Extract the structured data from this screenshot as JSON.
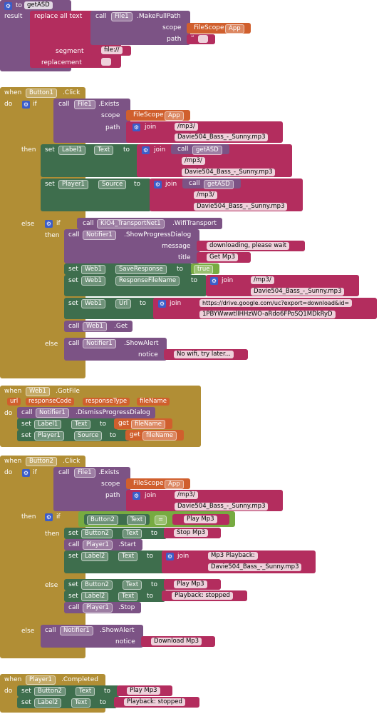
{
  "labels": {
    "to": "to",
    "result": "result",
    "call": "call",
    "when": "when",
    "do": "do",
    "if": "if",
    "then": "then",
    "else": "else",
    "set": "set",
    "get": "get",
    "join": "join",
    "scope": "scope",
    "path": "path",
    "segment": "segment",
    "replacement": "replacement",
    "replace_all_text": "replace all text",
    "message": "message",
    "title": "title",
    "notice": "notice",
    "eq": "=",
    "url": "url",
    "responseCode": "responseCode",
    "responseType": "responseType",
    "fileName": "fileName"
  },
  "proc": {
    "name": "getASD",
    "file_comp": "File1",
    "method": ".MakeFullPath",
    "scope_comp": "FileScope",
    "scope_val": "App",
    "path_val": "",
    "segment_val": "file://",
    "replacement_val": ""
  },
  "button1": {
    "component": "Button1",
    "event": ".Click",
    "file": "File1",
    "exists": ".Exists",
    "scope_comp": "FileScope",
    "scope_val": "App",
    "path1": "/mp3/",
    "path2": "Davie504_Bass_-_Sunny.mp3",
    "label": "Label1",
    "text_prop": "Text",
    "getasd": "getASD",
    "lbl_path1": "/mp3/",
    "lbl_path2": "Davie504_Bass_-_Sunny.mp3",
    "player": "Player1",
    "source_prop": "Source",
    "pl_getasd": "getASD",
    "pl_path1": "/mp3/",
    "pl_path2": "Davie504_Bass_-_Sunny.mp3",
    "kio": "KIO4_TransportNet1",
    "wifi": ".WifiTransport",
    "notifier": "Notifier1",
    "show_progress": ".ShowProgressDialog",
    "message": "downloading, please wait",
    "title": "Get Mp3",
    "web": "Web1",
    "save_prop": "SaveResponse",
    "true_val": "true",
    "resp_file_prop": "ResponseFileName",
    "rf_path1": "/mp3/",
    "rf_path2": "Davie504_Bass_-_Sunny.mp3",
    "url_prop": "Url",
    "url1": "https://drive.google.com/uc?export=download&id=",
    "url2": "1PBYWwwtlIHHzWO-aRdo6FPoSQ1MDkRyD",
    "get_method": ".Get",
    "show_alert": ".ShowAlert",
    "no_wifi": "No wifi, try later..."
  },
  "web1": {
    "component": "Web1",
    "event": ".GotFile",
    "notifier": "Notifier1",
    "dismiss": ".DismissProgressDialog",
    "label": "Label1",
    "text_prop": "Text",
    "get_name": "fileName",
    "player": "Player1",
    "source_prop": "Source"
  },
  "button2": {
    "component": "Button2",
    "event": ".Click",
    "file": "File1",
    "exists": ".Exists",
    "scope_comp": "FileScope",
    "scope_val": "App",
    "path1": "/mp3/",
    "path2": "Davie504_Bass_-_Sunny.mp3",
    "btn": "Button2",
    "text_prop": "Text",
    "play_mp3": "Play Mp3",
    "stop_mp3": "Stop Mp3",
    "player": "Player1",
    "start": ".Start",
    "label2": "Label2",
    "mp3_playback": "Mp3 Playback:",
    "lbl_path": "Davie504_Bass_-_Sunny.mp3",
    "play_mp3_2": "Play Mp3",
    "stopped": "Playback: stopped",
    "stop": ".Stop",
    "notifier": "Notifier1",
    "show_alert": ".ShowAlert",
    "download": "Download Mp3"
  },
  "player1": {
    "component": "Player1",
    "event": ".Completed",
    "btn": "Button2",
    "text_prop": "Text",
    "play_mp3": "Play Mp3",
    "label": "Label2",
    "stopped": "Playback: stopped"
  },
  "colors": {
    "procedure": "#7c5385",
    "control": "#b18e35",
    "text": "#b32d5e",
    "component": "#3e6e4d",
    "variable": "#d05f2d",
    "logic": "#77ab41"
  }
}
